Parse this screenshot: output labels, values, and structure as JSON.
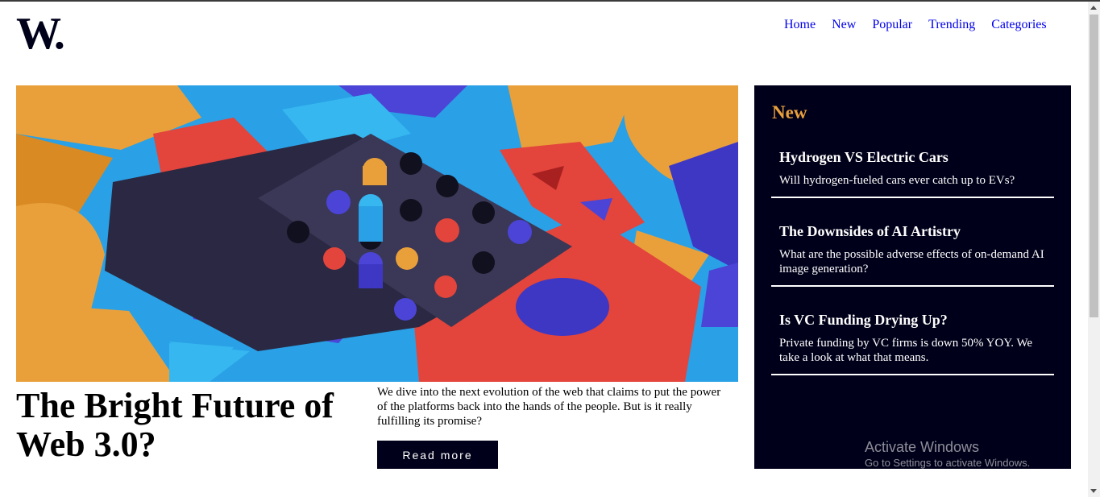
{
  "logo": {
    "text": "W."
  },
  "nav": {
    "items": [
      "Home",
      "New",
      "Popular",
      "Trending",
      "Categories"
    ]
  },
  "hero": {
    "image": "abstract-3d-blocks-illustration",
    "title": "The Bright Future of Web 3.0?",
    "description": "We dive into the next evolution of the web that claims to put the power of the platforms back into the hands of the people. But is it really fulfilling its promise?",
    "button_label": "Read more"
  },
  "sidebar": {
    "heading": "New",
    "items": [
      {
        "title": "Hydrogen VS Electric Cars",
        "text": "Will hydrogen-fueled cars ever catch up to EVs?"
      },
      {
        "title": "The Downsides of AI Artistry",
        "text": "What are the possible adverse effects of on-demand AI image generation?"
      },
      {
        "title": "Is VC Funding Drying Up?",
        "text": "Private funding by VC firms is down 50% YOY. We take a look at what that means."
      }
    ]
  },
  "watermark": {
    "line1": "Activate Windows",
    "line2": "Go to Settings to activate Windows."
  },
  "colors": {
    "navy": "#00001a",
    "accent": "#e9a03b",
    "link": "#0000ee"
  }
}
